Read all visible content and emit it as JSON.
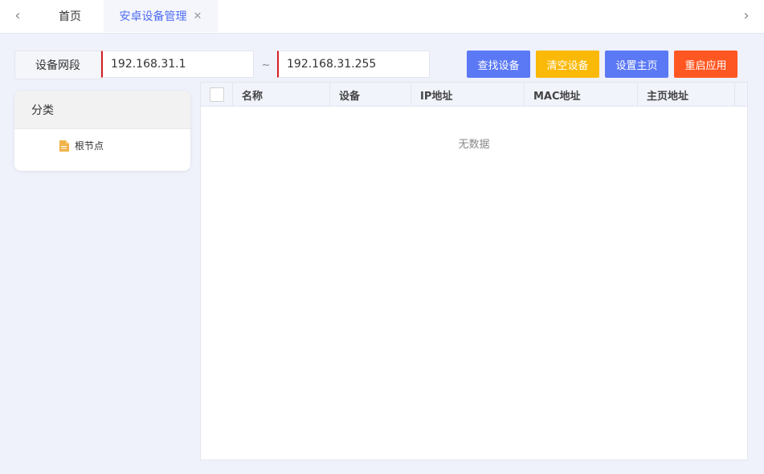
{
  "tabs": {
    "home_label": "首页",
    "active_label": "安卓设备管理",
    "close_glyph": "✕",
    "nav_left_glyph": "‹",
    "nav_right_glyph": "›"
  },
  "range": {
    "label": "设备网段",
    "start_value": "192.168.31.1",
    "separator": "~",
    "end_value": "192.168.31.255"
  },
  "buttons": {
    "find": "查找设备",
    "clear": "清空设备",
    "set_home": "设置主页",
    "restart": "重启应用"
  },
  "category": {
    "title": "分类",
    "root_node": "根节点"
  },
  "table": {
    "columns": [
      "名称",
      "设备",
      "IP地址",
      "MAC地址",
      "主页地址"
    ],
    "empty_text": "无数据",
    "rows": []
  },
  "colors": {
    "primary": "#5b79f5",
    "warning": "#fbb907",
    "danger": "#ff5722",
    "active_tab_text": "#4f6df5",
    "background": "#eff1fb"
  },
  "icons": {
    "nav_left": "chevron-left-icon",
    "nav_right": "chevron-right-icon",
    "tab_close": "close-icon",
    "tree_node": "file-icon"
  }
}
